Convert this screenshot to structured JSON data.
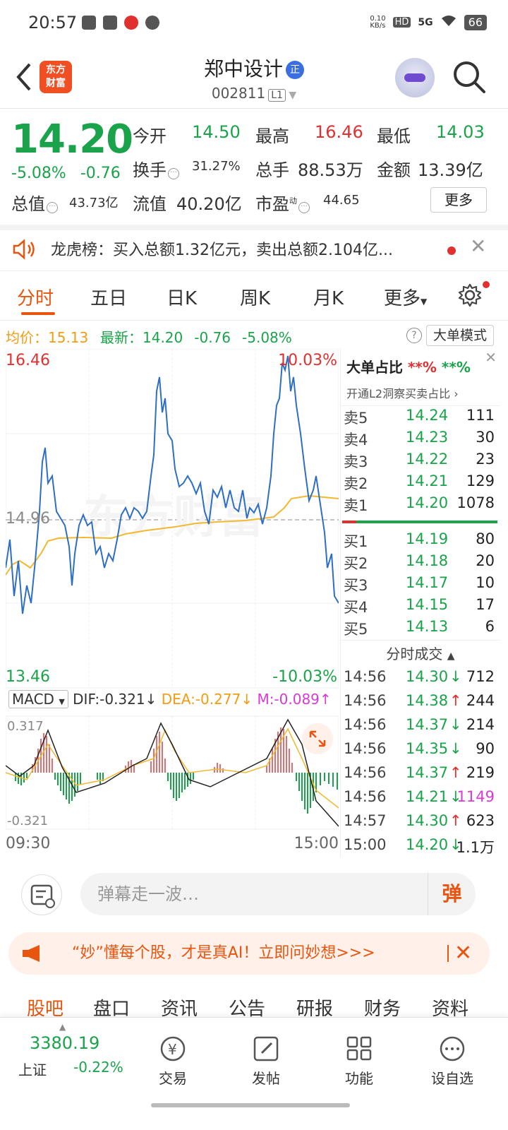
{
  "status": {
    "time": "20:57",
    "net": "0.10\nKB/s",
    "hd": "HD",
    "sig": "5G",
    "battery": "66"
  },
  "header": {
    "logo": "东方\n财富",
    "stock_name": "郑中设计",
    "badge": "正",
    "code": "002811",
    "level": "L1"
  },
  "quote": {
    "price": "14.20",
    "pct": "-5.08%",
    "chg": "-0.76",
    "open_label": "今开",
    "open": "14.50",
    "high_label": "最高",
    "high": "16.46",
    "low_label": "最低",
    "low": "14.03",
    "turnover_label": "换手",
    "turnover": "31.27%",
    "vol_label": "总手",
    "vol": "88.53万",
    "amount_label": "金额",
    "amount": "13.39亿",
    "mcap_label": "总值",
    "mcap": "43.73亿",
    "float_label": "流值",
    "float": "40.20亿",
    "pe_label": "市盈",
    "pe_sup": "动",
    "pe": "44.65",
    "more": "更多"
  },
  "notice": {
    "text": "龙虎榜：买入总额1.32亿元，卖出总额2.104亿..."
  },
  "tabs": [
    "分时",
    "五日",
    "日K",
    "周K",
    "月K",
    "更多"
  ],
  "info": {
    "avg_label": "均价：",
    "avg": "15.13",
    "latest_label": "最新：",
    "latest": "14.20",
    "chg": "-0.76",
    "pct": "-5.08%",
    "help": "?",
    "big_mode": "大单模式"
  },
  "chart": {
    "y_top": "16.46",
    "y_top_pct": "10.03%",
    "y_mid": "14.96",
    "y_bot": "13.46",
    "y_bot_pct": "-10.03%",
    "macd_sel": "MACD",
    "dif": "DIF:-0.321",
    "dea": "DEA:-0.277",
    "m": "M:-0.089",
    "macd_top": "0.317",
    "macd_bot": "-0.321",
    "t_start": "09:30",
    "t_end": "15:00",
    "colors": {
      "price": "#2e6fc2",
      "avg": "#f3b830",
      "up": "#e03030",
      "down": "#1aa34a"
    }
  },
  "chart_data": {
    "type": "line",
    "x": [
      "09:30",
      "10:30",
      "11:30/13:00",
      "14:00",
      "15:00"
    ],
    "series": [],
    "ylim": [
      13.46,
      16.46
    ]
  },
  "book": {
    "title": "大单占比",
    "v1": "**%",
    "v2": "**%",
    "l2": "开通L2洞察买卖占比",
    "asks": [
      {
        "n": "卖5",
        "p": "14.24",
        "v": "111"
      },
      {
        "n": "卖4",
        "p": "14.23",
        "v": "30"
      },
      {
        "n": "卖3",
        "p": "14.22",
        "v": "23"
      },
      {
        "n": "卖2",
        "p": "14.21",
        "v": "129"
      },
      {
        "n": "卖1",
        "p": "14.20",
        "v": "1078"
      }
    ],
    "bids": [
      {
        "n": "买1",
        "p": "14.19",
        "v": "80"
      },
      {
        "n": "买2",
        "p": "14.18",
        "v": "20"
      },
      {
        "n": "买3",
        "p": "14.17",
        "v": "10"
      },
      {
        "n": "买4",
        "p": "14.15",
        "v": "17"
      },
      {
        "n": "买5",
        "p": "14.13",
        "v": "6"
      }
    ],
    "tape_title": "分时成交",
    "tape": [
      {
        "t": "14:56",
        "p": "14.30",
        "d": "↓",
        "v": "712"
      },
      {
        "t": "14:56",
        "p": "14.38",
        "d": "↑",
        "v": "244"
      },
      {
        "t": "14:56",
        "p": "14.37",
        "d": "↓",
        "v": "214"
      },
      {
        "t": "14:56",
        "p": "14.35",
        "d": "↓",
        "v": "90"
      },
      {
        "t": "14:56",
        "p": "14.37",
        "d": "↑",
        "v": "219"
      },
      {
        "t": "14:56",
        "p": "14.21",
        "d": "↓",
        "v": "1149"
      },
      {
        "t": "14:57",
        "p": "14.30",
        "d": "↑",
        "v": "623"
      },
      {
        "t": "15:00",
        "p": "14.20",
        "d": "↓",
        "v": "1.1万"
      }
    ]
  },
  "danmu": {
    "placeholder": "弹幕走一波…",
    "btn": "弹"
  },
  "promo": {
    "text": "“妙”懂每个股，才是真AI！立即问妙想>>>"
  },
  "btabs": [
    "股吧",
    "盘口",
    "资讯",
    "公告",
    "研报",
    "财务",
    "资料"
  ],
  "nav": {
    "index_value": "3380.19",
    "index_name": "上证",
    "index_pct": "-0.22%",
    "items": [
      "交易",
      "发帖",
      "功能",
      "设自选"
    ]
  }
}
